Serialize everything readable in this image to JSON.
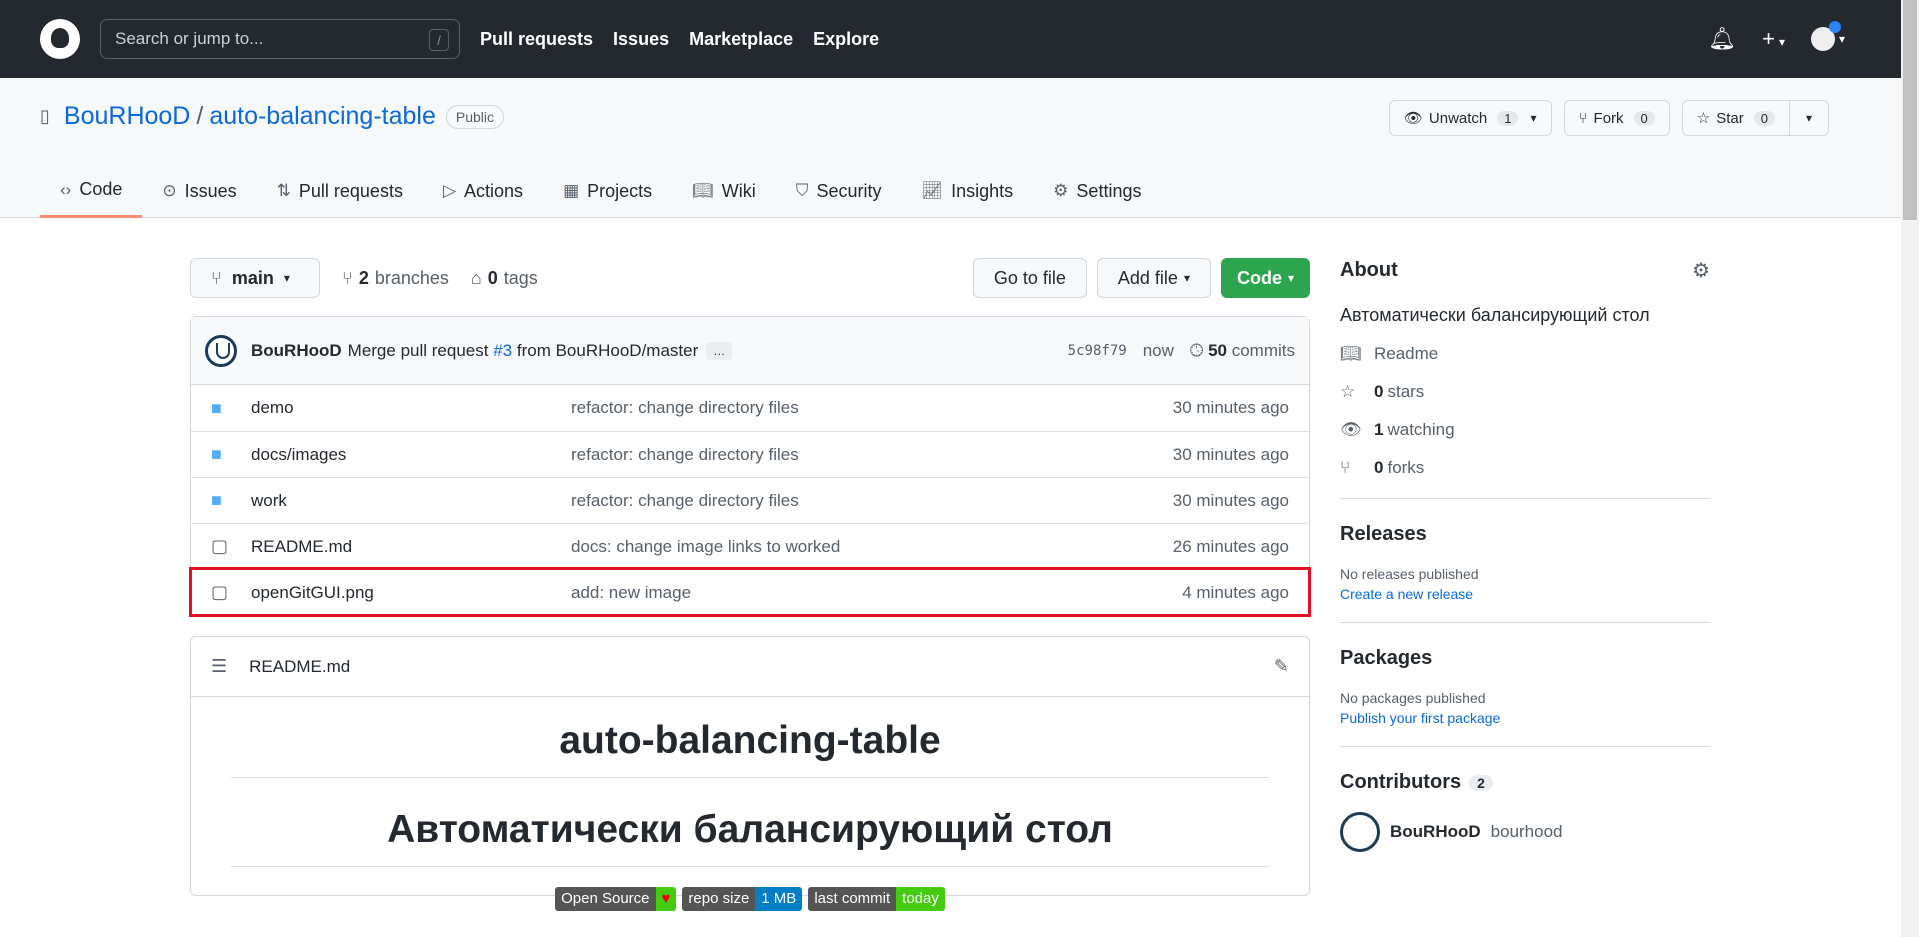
{
  "navbar": {
    "search_placeholder": "Search or jump to...",
    "search_shortcut": "/",
    "links": [
      "Pull requests",
      "Issues",
      "Marketplace",
      "Explore"
    ]
  },
  "repo": {
    "owner": "BouRHooD",
    "separator": "/",
    "name": "auto-balancing-table",
    "visibility": "Public",
    "watch_label": "Unwatch",
    "watch_count": "1",
    "fork_label": "Fork",
    "fork_count": "0",
    "star_label": "Star",
    "star_count": "0"
  },
  "tabs": [
    {
      "label": "Code",
      "icon": "code-icon"
    },
    {
      "label": "Issues",
      "icon": "issue-icon"
    },
    {
      "label": "Pull requests",
      "icon": "pull-request-icon"
    },
    {
      "label": "Actions",
      "icon": "play-icon"
    },
    {
      "label": "Projects",
      "icon": "project-icon"
    },
    {
      "label": "Wiki",
      "icon": "book-icon"
    },
    {
      "label": "Security",
      "icon": "shield-icon"
    },
    {
      "label": "Insights",
      "icon": "graph-icon"
    },
    {
      "label": "Settings",
      "icon": "gear-icon"
    }
  ],
  "toolbar": {
    "branch": "main",
    "branches_count": "2",
    "branches_label": "branches",
    "tags_count": "0",
    "tags_label": "tags",
    "goto_file": "Go to file",
    "add_file": "Add file",
    "code": "Code"
  },
  "commit": {
    "author": "BouRHooD",
    "message_prefix": "Merge pull request",
    "pr_ref": "#3",
    "message_suffix": "from BouRHooD/master",
    "ellipsis": "…",
    "sha": "5c98f79",
    "time": "now",
    "commits_count": "50",
    "commits_label": "commits"
  },
  "files": [
    {
      "name": "demo",
      "type": "dir",
      "message": "refactor: change directory files",
      "age": "30 minutes ago"
    },
    {
      "name": "docs/images",
      "type": "dir",
      "message": "refactor: change directory files",
      "age": "30 minutes ago"
    },
    {
      "name": "work",
      "type": "dir",
      "message": "refactor: change directory files",
      "age": "30 minutes ago"
    },
    {
      "name": "README.md",
      "type": "file",
      "message": "docs: change image links to worked",
      "age": "26 minutes ago"
    },
    {
      "name": "openGitGUI.png",
      "type": "file",
      "message": "add: new image",
      "age": "4 minutes ago"
    }
  ],
  "readme": {
    "filename": "README.md",
    "title": "auto-balancing-table",
    "subtitle": "Автоматически балансирующий стол",
    "badges": [
      {
        "left": "Open Source",
        "right": "♥"
      },
      {
        "left": "repo size",
        "right": "1 MB"
      },
      {
        "left": "last commit",
        "right": "today"
      }
    ]
  },
  "about": {
    "title": "About",
    "description": "Автоматически балансирующий стол",
    "readme": "Readme",
    "stars_count": "0",
    "stars_label": "stars",
    "watching_count": "1",
    "watching_label": "watching",
    "forks_count": "0",
    "forks_label": "forks"
  },
  "releases": {
    "title": "Releases",
    "empty": "No releases published",
    "link": "Create a new release"
  },
  "packages": {
    "title": "Packages",
    "empty": "No packages published",
    "link": "Publish your first package"
  },
  "contributors": {
    "title": "Contributors",
    "count": "2",
    "first_name": "BouRHooD",
    "first_login": "bourhood"
  },
  "colors": {
    "navbar": "#24292f",
    "link": "#0969da",
    "green_button": "#2da44e",
    "highlight": "#e0141e",
    "active_tab": "#fd8c73"
  }
}
